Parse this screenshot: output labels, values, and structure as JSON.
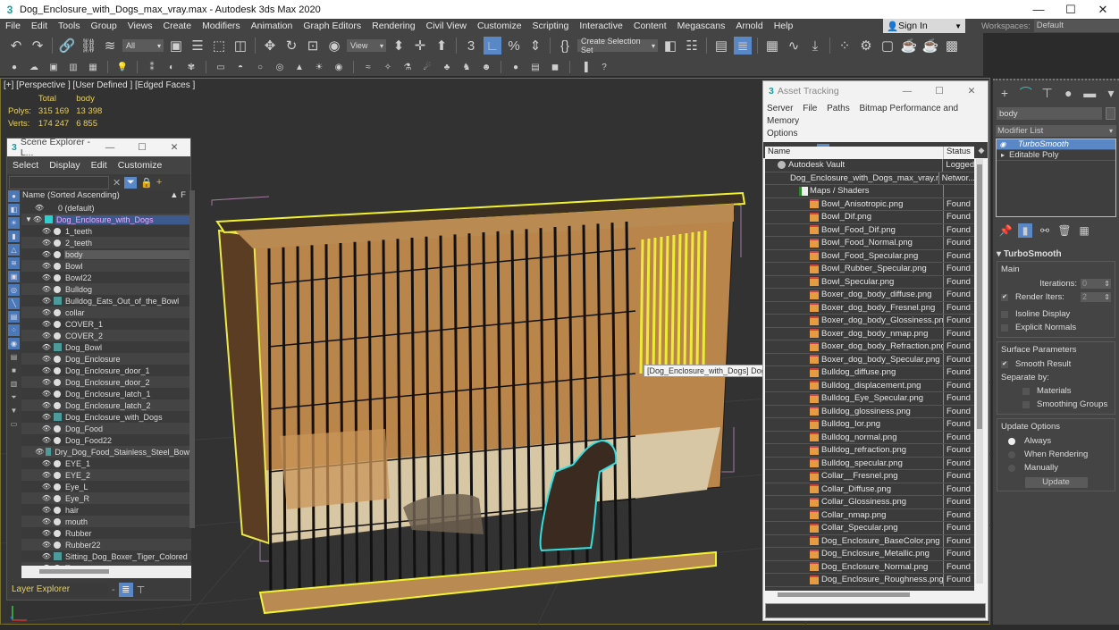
{
  "window": {
    "title": "Dog_Enclosure_with_Dogs_max_vray.max - Autodesk 3ds Max 2020",
    "minimize_icon": "minimize-icon",
    "maximize_icon": "maximize-icon",
    "close_icon": "close-icon"
  },
  "menubar": {
    "items": [
      "File",
      "Edit",
      "Tools",
      "Group",
      "Views",
      "Create",
      "Modifiers",
      "Animation",
      "Graph Editors",
      "Rendering",
      "Civil View",
      "Customize",
      "Scripting",
      "Interactive",
      "Content",
      "Megascans",
      "Arnold",
      "Help"
    ],
    "sign_in": "Sign In",
    "workspaces_label": "Workspaces:",
    "workspaces_value": "Default"
  },
  "toolbar": {
    "selection_filter": "All",
    "reference_coord": "View",
    "selection_set_placeholder": "Create Selection Set",
    "snap_label": "3"
  },
  "viewport": {
    "label": "[+] [Perspective ] [User Defined ] [Edged Faces ]",
    "stats": {
      "col_total": "Total",
      "col_selected": "body",
      "polys_label": "Polys:",
      "polys_total": "315 169",
      "polys_selected": "13 398",
      "verts_label": "Verts:",
      "verts_total": "174 247",
      "verts_selected": "6 855"
    },
    "tooltip": "[Dog_Enclosure_with_Dogs] Dog_Enclosure"
  },
  "scene_explorer": {
    "title": "Scene Explorer - L...",
    "menu": [
      "Select",
      "Display",
      "Edit",
      "Customize"
    ],
    "column_name": "Name (Sorted Ascending)",
    "column_f": "▲ F",
    "rows": [
      {
        "name": "0 (default)",
        "type": "layer-default",
        "level": 1
      },
      {
        "name": "Dog_Enclosure_with_Dogs",
        "type": "layer",
        "level": 0
      },
      {
        "name": "1_teeth",
        "type": "object"
      },
      {
        "name": "2_teeth",
        "type": "object"
      },
      {
        "name": "body",
        "type": "object",
        "selected": true
      },
      {
        "name": "Bowl",
        "type": "object"
      },
      {
        "name": "Bowl22",
        "type": "object"
      },
      {
        "name": "Bulldog",
        "type": "object"
      },
      {
        "name": "Bulldog_Eats_Out_of_the_Bowl",
        "type": "group"
      },
      {
        "name": "collar",
        "type": "object"
      },
      {
        "name": "COVER_1",
        "type": "object"
      },
      {
        "name": "COVER_2",
        "type": "object"
      },
      {
        "name": "Dog_Bowl",
        "type": "group"
      },
      {
        "name": "Dog_Enclosure",
        "type": "object"
      },
      {
        "name": "Dog_Enclosure_door_1",
        "type": "object"
      },
      {
        "name": "Dog_Enclosure_door_2",
        "type": "object"
      },
      {
        "name": "Dog_Enclosure_latch_1",
        "type": "object"
      },
      {
        "name": "Dog_Enclosure_latch_2",
        "type": "object"
      },
      {
        "name": "Dog_Enclosure_with_Dogs",
        "type": "group"
      },
      {
        "name": "Dog_Food",
        "type": "object"
      },
      {
        "name": "Dog_Food22",
        "type": "object"
      },
      {
        "name": "Dry_Dog_Food_Stainless_Steel_Bowl",
        "type": "group"
      },
      {
        "name": "EYE_1",
        "type": "object"
      },
      {
        "name": "EYE_2",
        "type": "object"
      },
      {
        "name": "Eye_L",
        "type": "object"
      },
      {
        "name": "Eye_R",
        "type": "object"
      },
      {
        "name": "hair",
        "type": "object"
      },
      {
        "name": "mouth",
        "type": "object"
      },
      {
        "name": "Rubber",
        "type": "object"
      },
      {
        "name": "Rubber22",
        "type": "object"
      },
      {
        "name": "Sitting_Dog_Boxer_Tiger_Colored",
        "type": "group"
      },
      {
        "name": "Tongue",
        "type": "object"
      }
    ],
    "explorer_select": "Layer Explorer"
  },
  "asset_tracking": {
    "title": "Asset Tracking",
    "menu": [
      "Server",
      "File",
      "Paths",
      "Bitmap Performance and Memory",
      "Options"
    ],
    "col_name": "Name",
    "col_status": "Status",
    "rows": [
      {
        "name": "Autodesk Vault",
        "status": "Logged",
        "icon": "vault",
        "indent": 1
      },
      {
        "name": "Dog_Enclosure_with_Dogs_max_vray.max",
        "status": "Networ...",
        "icon": "max",
        "indent": 2
      },
      {
        "name": "Maps / Shaders",
        "status": "",
        "icon": "maps",
        "indent": 3
      },
      {
        "name": "Bowl_Anisotropic.png",
        "status": "Found",
        "icon": "file",
        "indent": 4
      },
      {
        "name": "Bowl_Dif.png",
        "status": "Found",
        "icon": "file",
        "indent": 4
      },
      {
        "name": "Bowl_Food_Dif.png",
        "status": "Found",
        "icon": "file",
        "indent": 4
      },
      {
        "name": "Bowl_Food_Normal.png",
        "status": "Found",
        "icon": "file",
        "indent": 4
      },
      {
        "name": "Bowl_Food_Specular.png",
        "status": "Found",
        "icon": "file",
        "indent": 4
      },
      {
        "name": "Bowl_Rubber_Specular.png",
        "status": "Found",
        "icon": "file",
        "indent": 4
      },
      {
        "name": "Bowl_Specular.png",
        "status": "Found",
        "icon": "file",
        "indent": 4
      },
      {
        "name": "Boxer_dog_body_diffuse.png",
        "status": "Found",
        "icon": "file",
        "indent": 4
      },
      {
        "name": "Boxer_dog_body_Fresnel.png",
        "status": "Found",
        "icon": "file",
        "indent": 4
      },
      {
        "name": "Boxer_dog_body_Glossiness.png",
        "status": "Found",
        "icon": "file",
        "indent": 4
      },
      {
        "name": "Boxer_dog_body_nmap.png",
        "status": "Found",
        "icon": "file",
        "indent": 4
      },
      {
        "name": "Boxer_dog_body_Refraction.png",
        "status": "Found",
        "icon": "file",
        "indent": 4
      },
      {
        "name": "Boxer_dog_body_Specular.png",
        "status": "Found",
        "icon": "file",
        "indent": 4
      },
      {
        "name": "Bulldog_diffuse.png",
        "status": "Found",
        "icon": "file",
        "indent": 4
      },
      {
        "name": "Bulldog_displacement.png",
        "status": "Found",
        "icon": "file",
        "indent": 4
      },
      {
        "name": "Bulldog_Eye_Specular.png",
        "status": "Found",
        "icon": "file",
        "indent": 4
      },
      {
        "name": "Bulldog_glossiness.png",
        "status": "Found",
        "icon": "file",
        "indent": 4
      },
      {
        "name": "Bulldog_Ior.png",
        "status": "Found",
        "icon": "file",
        "indent": 4
      },
      {
        "name": "Bulldog_normal.png",
        "status": "Found",
        "icon": "file",
        "indent": 4
      },
      {
        "name": "Bulldog_refraction.png",
        "status": "Found",
        "icon": "file",
        "indent": 4
      },
      {
        "name": "Bulldog_specular.png",
        "status": "Found",
        "icon": "file",
        "indent": 4
      },
      {
        "name": "Collar__Fresnel.png",
        "status": "Found",
        "icon": "file",
        "indent": 4
      },
      {
        "name": "Collar_Diffuse.png",
        "status": "Found",
        "icon": "file",
        "indent": 4
      },
      {
        "name": "Collar_Glossiness.png",
        "status": "Found",
        "icon": "file",
        "indent": 4
      },
      {
        "name": "Collar_nmap.png",
        "status": "Found",
        "icon": "file",
        "indent": 4
      },
      {
        "name": "Collar_Specular.png",
        "status": "Found",
        "icon": "file",
        "indent": 4
      },
      {
        "name": "Dog_Enclosure_BaseColor.png",
        "status": "Found",
        "icon": "file",
        "indent": 4
      },
      {
        "name": "Dog_Enclosure_Metallic.png",
        "status": "Found",
        "icon": "file",
        "indent": 4
      },
      {
        "name": "Dog_Enclosure_Normal.png",
        "status": "Found",
        "icon": "file",
        "indent": 4
      },
      {
        "name": "Dog_Enclosure_Roughness.png",
        "status": "Found",
        "icon": "file",
        "indent": 4
      }
    ]
  },
  "command_panel": {
    "object_name": "body",
    "modifier_list_label": "Modifier List",
    "stack": [
      {
        "name": "TurboSmooth",
        "selected": true
      },
      {
        "name": "Editable Poly",
        "selected": false
      }
    ],
    "rollout_title": "TurboSmooth",
    "main_label": "Main",
    "iterations_label": "Iterations:",
    "iterations_value": "0",
    "render_iters_label": "Render Iters:",
    "render_iters_value": "2",
    "render_iters_checked": true,
    "isoline_label": "Isoline Display",
    "explicit_normals_label": "Explicit Normals",
    "surface_params_label": "Surface Parameters",
    "smooth_result_label": "Smooth Result",
    "separate_by_label": "Separate by:",
    "materials_label": "Materials",
    "smoothing_groups_label": "Smoothing Groups",
    "update_options_label": "Update Options",
    "always_label": "Always",
    "when_rendering_label": "When Rendering",
    "manually_label": "Manually",
    "update_button": "Update",
    "selected_update_option": "Always"
  },
  "colors": {
    "accent_blue": "#5a87c6",
    "selection_yellow": "#f2f230",
    "selection_cyan": "#33e0e0",
    "stats_yellow": "#e8d05a"
  }
}
